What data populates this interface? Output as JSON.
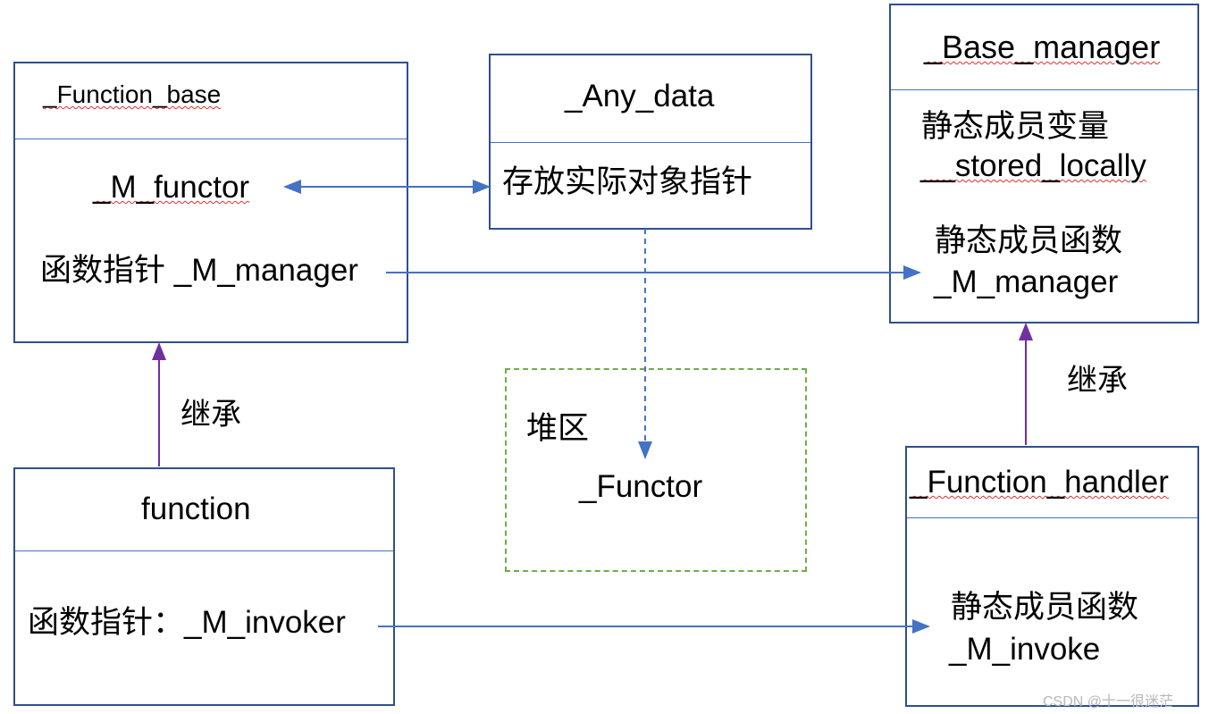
{
  "function_base": {
    "title": "_Function_base",
    "member1": "_M_functor",
    "member2": "函数指针 _M_manager"
  },
  "any_data": {
    "title": "_Any_data",
    "member": "存放实际对象指针"
  },
  "base_manager": {
    "title": "_Base_manager",
    "var_label": "静态成员变量",
    "var_name": "__stored_locally",
    "func_label": "静态成员函数",
    "func_name": "_M_manager"
  },
  "function": {
    "title": "function",
    "member": "函数指针：_M_invoker"
  },
  "function_handler": {
    "title": "_Function_handler",
    "func_label": "静态成员函数",
    "func_name": "_M_invoke"
  },
  "heap": {
    "label": "堆区",
    "content": "_Functor"
  },
  "inherit_label_left": "继承",
  "inherit_label_right": "继承",
  "watermark": "CSDN @十一很迷茫",
  "colors": {
    "box_border": "#2f4f8f",
    "arrow": "#4472c4",
    "inherit_arrow": "#7030a0",
    "heap_border": "#70ad47"
  }
}
